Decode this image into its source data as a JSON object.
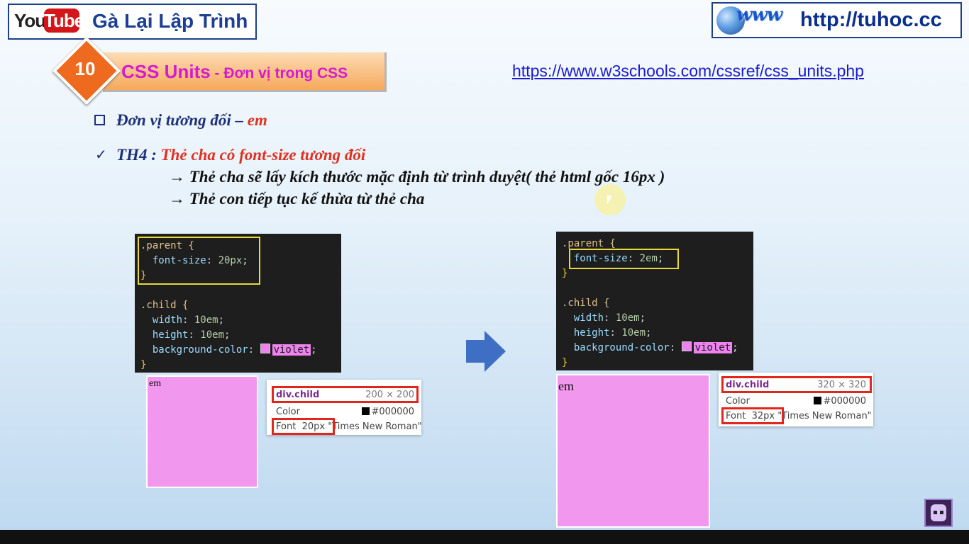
{
  "header": {
    "youtube_you": "You",
    "youtube_tube": "Tube",
    "channel_name": "Gà Lại Lập Trình",
    "www_logo": "www",
    "site_url": "http://tuhoc.cc"
  },
  "lesson": {
    "number": "10",
    "title": "CSS Units",
    "subtitle": " - Đơn vị trong CSS",
    "reference_link": "https://www.w3schools.com/cssref/css_units.php"
  },
  "content": {
    "heading_prefix": "Đơn vị tương đối – ",
    "heading_unit": "em",
    "case_prefix": "TH4 : ",
    "case_text": "Thẻ cha có font-size tương đối",
    "line1": "→ Thẻ cha sẽ lấy kích thước mặc định từ trình duyệt( thẻ html gốc 16px )",
    "line2": "→ Thẻ con tiếp tục kế thừa từ thẻ cha"
  },
  "code_left": {
    "parent_selector": ".parent {",
    "parent_prop": "font-size",
    "parent_value": "20px",
    "close": "}",
    "child_selector": ".child {",
    "width_prop": "width",
    "width_value": "10em",
    "height_prop": "height",
    "height_value": "10em",
    "bg_prop": "background-color",
    "bg_value": "violet"
  },
  "code_right": {
    "parent_selector": ".parent {",
    "parent_prop": "font-size",
    "parent_value": "2em",
    "close": "}",
    "child_selector": ".child {",
    "width_prop": "width",
    "width_value": "10em",
    "height_prop": "height",
    "height_value": "10em",
    "bg_prop": "background-color",
    "bg_value": "violet"
  },
  "demo_left": {
    "box_text": "em",
    "tooltip_name": "div.child",
    "tooltip_size": "200 × 200",
    "color_label": "Color",
    "color_value": "#000000",
    "font_label": "Font",
    "font_size": "20px",
    "font_family": "\"Times New Roman\""
  },
  "demo_right": {
    "box_text": "em",
    "tooltip_name": "div.child",
    "tooltip_size": "320 × 320",
    "color_label": "Color",
    "color_value": "#000000",
    "font_label": "Font",
    "font_size": "32px",
    "font_family": "\"Times New Roman\""
  },
  "colors": {
    "violet": "#ee82ee",
    "highlight_yellow": "#e8d93a",
    "highlight_red": "#e1261c",
    "title_magenta": "#d61ad0",
    "badge_orange": "#ee6a1e"
  }
}
